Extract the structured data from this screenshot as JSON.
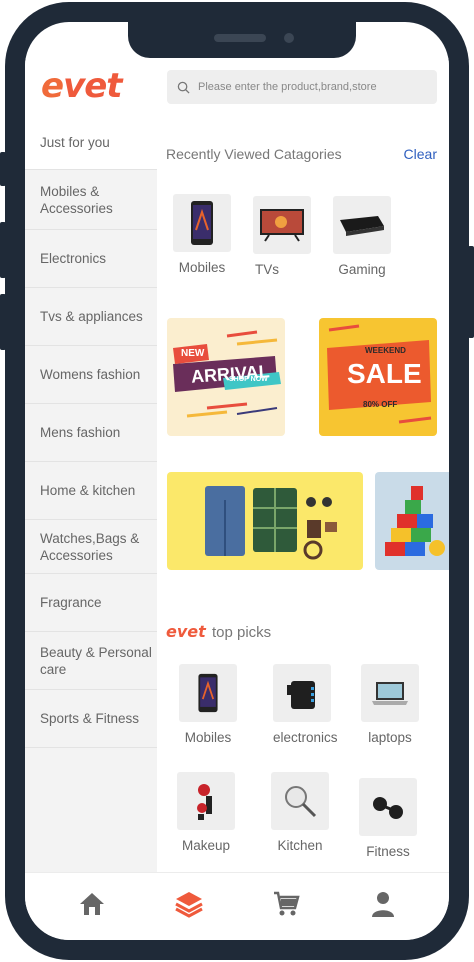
{
  "brand": {
    "logo_e": "e",
    "logo_rest": "vet",
    "accent_color": "#ef5a3c"
  },
  "search": {
    "placeholder": "Please enter the product,brand,store"
  },
  "sidebar": {
    "items": [
      {
        "label": "Just for you",
        "active": true
      },
      {
        "label": "Mobiles & Accessories"
      },
      {
        "label": "Electronics"
      },
      {
        "label": "Tvs & appliances"
      },
      {
        "label": "Womens fashion"
      },
      {
        "label": "Mens fashion"
      },
      {
        "label": "Home & kitchen"
      },
      {
        "label": "Watches,Bags & Accessories"
      },
      {
        "label": "Fragrance"
      },
      {
        "label": "Beauty & Personal care"
      },
      {
        "label": "Sports & Fitness"
      }
    ]
  },
  "recent": {
    "title": "Recently Viewed Catagories",
    "clear_label": "Clear",
    "items": [
      {
        "label": "Mobiles",
        "icon": "smartphone-icon"
      },
      {
        "label": "TVs",
        "icon": "tv-icon"
      },
      {
        "label": "Gaming",
        "icon": "game-console-icon"
      }
    ]
  },
  "banners": {
    "new_arrival": {
      "line1": "NEW",
      "line2": "ARRIVAL",
      "cta": "SHOP NOW"
    },
    "sale": {
      "top": "WEEKEND",
      "main": "SALE",
      "bottom": "80% OFF"
    }
  },
  "top_picks": {
    "logo": "evet",
    "title": "top picks",
    "items": [
      {
        "label": "Mobiles",
        "icon": "smartphone-icon"
      },
      {
        "label": "electronics",
        "icon": "charger-icon"
      },
      {
        "label": "laptops",
        "icon": "laptop-icon"
      },
      {
        "label": "Makeup",
        "icon": "makeup-icon"
      },
      {
        "label": "Kitchen",
        "icon": "magnifier-icon"
      },
      {
        "label": "Fitness",
        "icon": "dumbbell-icon"
      }
    ]
  },
  "tabbar": {
    "items": [
      {
        "icon": "home-icon",
        "active": false
      },
      {
        "icon": "layers-icon",
        "active": true
      },
      {
        "icon": "cart-icon",
        "active": false
      },
      {
        "icon": "user-icon",
        "active": false
      }
    ],
    "active_color": "#ef5a3c",
    "inactive_color": "#666666"
  }
}
